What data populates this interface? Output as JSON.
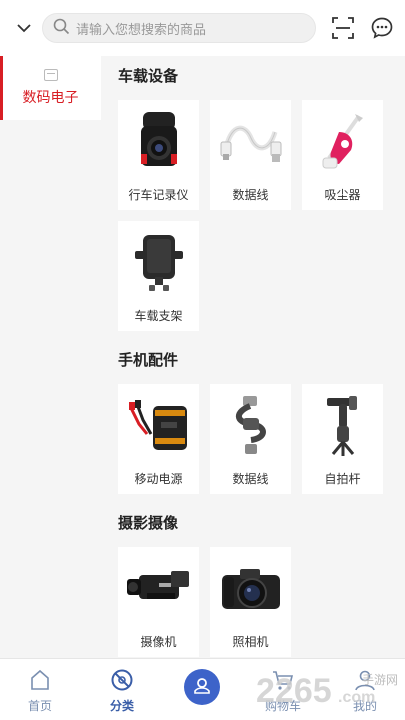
{
  "header": {
    "search_placeholder": "请输入您想搜索的商品"
  },
  "sidebar": {
    "items": [
      {
        "label": "数码电子",
        "active": true
      }
    ]
  },
  "sections": [
    {
      "title": "车载设备",
      "products": [
        {
          "name": "行车记录仪"
        },
        {
          "name": "数据线"
        },
        {
          "name": "吸尘器"
        },
        {
          "name": "车载支架"
        }
      ]
    },
    {
      "title": "手机配件",
      "products": [
        {
          "name": "移动电源"
        },
        {
          "name": "数据线"
        },
        {
          "name": "自拍杆"
        }
      ]
    },
    {
      "title": "摄影摄像",
      "products": [
        {
          "name": "摄像机"
        },
        {
          "name": "照相机"
        }
      ]
    }
  ],
  "bottom_nav": {
    "items": [
      {
        "label": "首页",
        "icon": "home-icon"
      },
      {
        "label": "分类",
        "icon": "category-icon",
        "active": true
      },
      {
        "label": "",
        "icon": "center-action-icon"
      },
      {
        "label": "购物车",
        "icon": "cart-icon"
      },
      {
        "label": "我的",
        "icon": "profile-icon"
      }
    ]
  },
  "watermark": {
    "text": "2265.com",
    "site": "手游网"
  },
  "colors": {
    "accent_red": "#d81e24",
    "nav_blue": "#3d63c9"
  }
}
